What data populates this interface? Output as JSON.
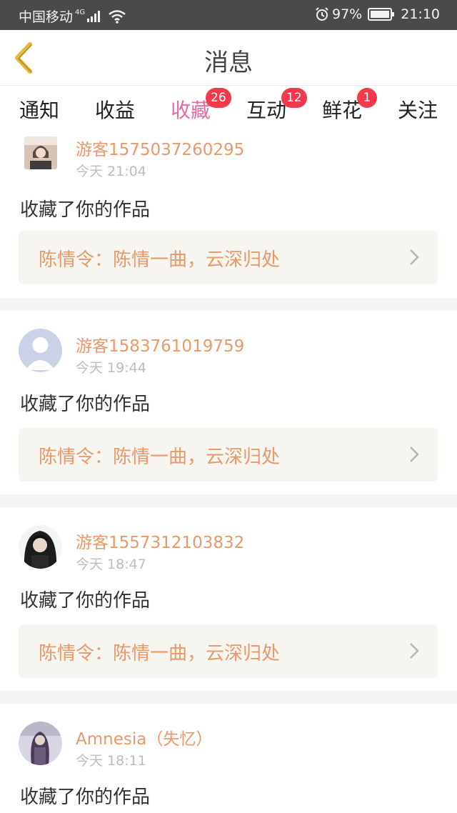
{
  "status_bar": {
    "carrier": "中国移动",
    "network": "4G",
    "battery": "97%",
    "time": "21:10"
  },
  "header": {
    "title": "消息"
  },
  "tabs": [
    {
      "label": "通知",
      "badge": ""
    },
    {
      "label": "收益",
      "badge": ""
    },
    {
      "label": "收藏",
      "badge": "26",
      "active": true
    },
    {
      "label": "互动",
      "badge": "12"
    },
    {
      "label": "鲜花",
      "badge": "1"
    },
    {
      "label": "关注",
      "badge": ""
    }
  ],
  "feed": [
    {
      "user": "游客1575037260295",
      "time": "今天 21:04",
      "action": "收藏了你的作品",
      "work": "陈情令：陈情一曲，云深归处"
    },
    {
      "user": "游客1583761019759",
      "time": "今天 19:44",
      "action": "收藏了你的作品",
      "work": "陈情令：陈情一曲，云深归处"
    },
    {
      "user": "游客1557312103832",
      "time": "今天 18:47",
      "action": "收藏了你的作品",
      "work": "陈情令：陈情一曲，云深归处"
    },
    {
      "user": "Amnesia（失忆）",
      "time": "今天 18:11",
      "action": "收藏了你的作品",
      "work": ""
    }
  ],
  "colors": {
    "accent": "#e36aa6",
    "badge": "#f23a4a",
    "username": "#e9996a",
    "work_box_bg": "#f6f5ef",
    "status_bar_bg": "#4a4a4a"
  }
}
